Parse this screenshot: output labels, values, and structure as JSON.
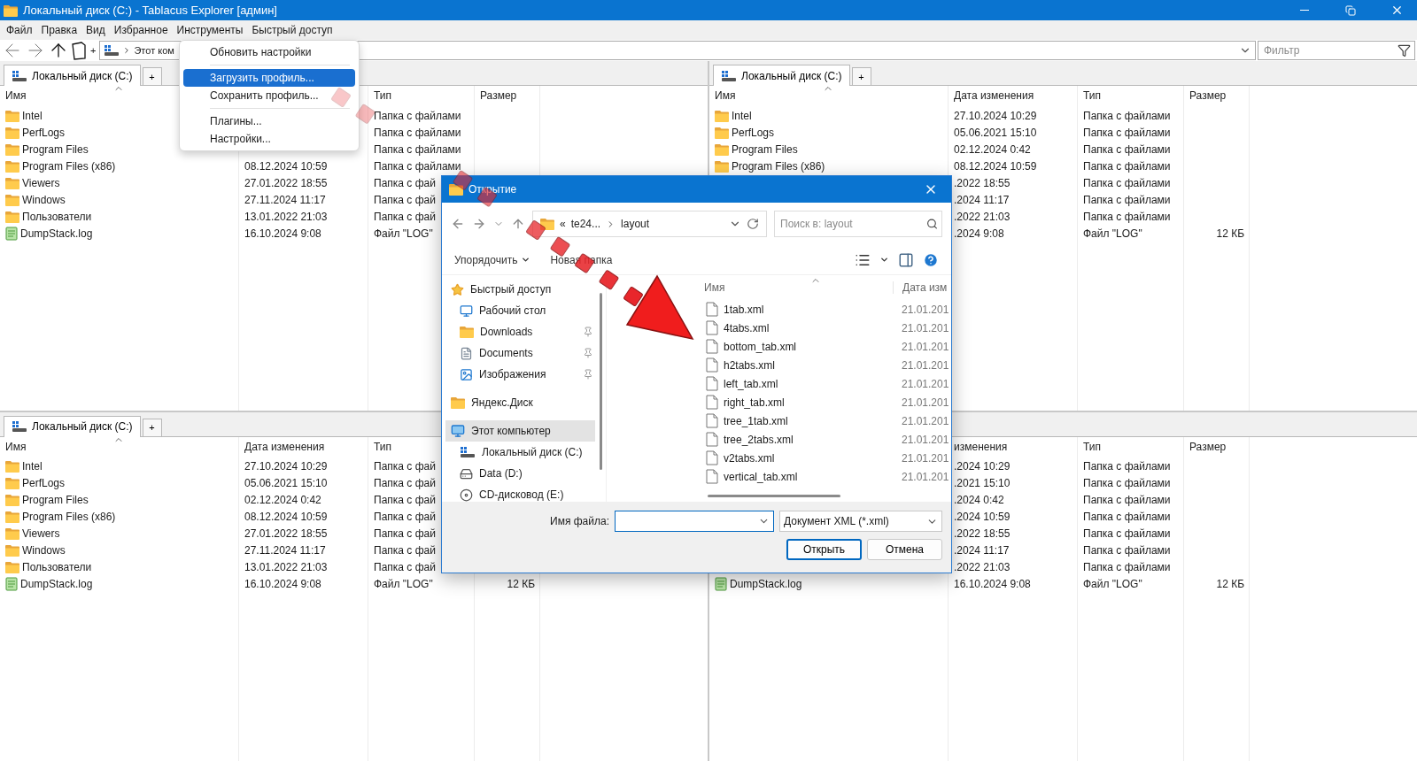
{
  "window": {
    "title": "Локальный диск (C:) - Tablacus Explorer [админ]"
  },
  "menu_bar": [
    "Файл",
    "Правка",
    "Вид",
    "Избранное",
    "Инструменты",
    "Быстрый доступ"
  ],
  "toolbar": {
    "new_tab": "+",
    "address": "Этот ком",
    "filter_placeholder": "Фильтр"
  },
  "tools_menu": [
    {
      "kind": "item",
      "label": "Обновить настройки",
      "selected": false
    },
    {
      "kind": "separator"
    },
    {
      "kind": "item",
      "label": "Загрузить профиль...",
      "selected": true
    },
    {
      "kind": "item",
      "label": "Сохранить профиль...",
      "selected": false
    },
    {
      "kind": "separator"
    },
    {
      "kind": "item",
      "label": "Плагины...",
      "selected": false
    },
    {
      "kind": "item",
      "label": "Настройки...",
      "selected": false
    }
  ],
  "panes": [
    {
      "tab": {
        "label": "Локальный диск (C:)",
        "selected": true
      },
      "new_tab": "+",
      "columns": [
        {
          "kind": "name",
          "label": "Имя"
        },
        {
          "kind": "date"
        },
        {
          "kind": "type",
          "label": "Тип"
        },
        {
          "kind": "size",
          "label": "Размер"
        }
      ],
      "rows": [
        {
          "kind": "folder",
          "name": "Intel",
          "type": "Папка с файлами"
        },
        {
          "kind": "folder",
          "name": "PerfLogs",
          "type": "Папка с файлами"
        },
        {
          "kind": "folder",
          "name": "Program Files",
          "type": "Папка с файлами"
        },
        {
          "kind": "folder",
          "name": "Program Files (x86)",
          "date": "08.12.2024 10:59",
          "type": "Папка с файлами"
        },
        {
          "kind": "folder",
          "name": "Viewers",
          "date": "27.01.2022 18:55",
          "type": "Папка с фай"
        },
        {
          "kind": "folder",
          "name": "Windows",
          "date": "27.11.2024 11:17",
          "type": "Папка с фай"
        },
        {
          "kind": "folder",
          "name": "Пользователи",
          "date": "13.01.2022 21:03",
          "type": "Папка с фай"
        },
        {
          "kind": "file",
          "name": "DumpStack.log",
          "date": "16.10.2024 9:08",
          "type": "Файл \"LOG\""
        }
      ]
    },
    {
      "tab": {
        "label": "Локальный диск (C:)",
        "selected": true
      },
      "new_tab": "+",
      "columns": [
        {
          "kind": "name",
          "label": "Имя"
        },
        {
          "kind": "date",
          "label": "Дата изменения"
        },
        {
          "kind": "type",
          "label": "Тип"
        },
        {
          "kind": "size",
          "label": "Размер"
        }
      ],
      "rows": [
        {
          "kind": "folder",
          "name": "Intel",
          "date": "27.10.2024 10:29",
          "type": "Папка с файлами"
        },
        {
          "kind": "folder",
          "name": "PerfLogs",
          "date": "05.06.2021 15:10",
          "type": "Папка с файлами"
        },
        {
          "kind": "folder",
          "name": "Program Files",
          "date": "02.12.2024 0:42",
          "type": "Папка с файлами"
        },
        {
          "kind": "folder",
          "name": "Program Files (x86)",
          "date": "08.12.2024 10:59",
          "type": "Папка с файлами"
        },
        {
          "date": ".2022 18:55",
          "type": "Папка с файлами"
        },
        {
          "date": ".2024 11:17",
          "type": "Папка с файлами"
        },
        {
          "date": ".2022 21:03",
          "type": "Папка с файлами"
        },
        {
          "date": ".2024 9:08",
          "type": "Файл \"LOG\"",
          "size": "12 КБ"
        }
      ]
    },
    {
      "tab": {
        "label": "Локальный диск (C:)",
        "selected": true
      },
      "new_tab": "+",
      "columns": [
        {
          "kind": "name",
          "label": "Имя"
        },
        {
          "kind": "date",
          "label": "Дата изменения"
        },
        {
          "kind": "type",
          "label": "Тип"
        },
        {
          "kind": "size"
        }
      ],
      "rows": [
        {
          "kind": "folder",
          "name": "Intel",
          "date": "27.10.2024 10:29",
          "type": "Папка с фай"
        },
        {
          "kind": "folder",
          "name": "PerfLogs",
          "date": "05.06.2021 15:10",
          "type": "Папка с фай"
        },
        {
          "kind": "folder",
          "name": "Program Files",
          "date": "02.12.2024 0:42",
          "type": "Папка с фай"
        },
        {
          "kind": "folder",
          "name": "Program Files (x86)",
          "date": "08.12.2024 10:59",
          "type": "Папка с фай"
        },
        {
          "kind": "folder",
          "name": "Viewers",
          "date": "27.01.2022 18:55",
          "type": "Папка с фай"
        },
        {
          "kind": "folder",
          "name": "Windows",
          "date": "27.11.2024 11:17",
          "type": "Папка с фай"
        },
        {
          "kind": "folder",
          "name": "Пользователи",
          "date": "13.01.2022 21:03",
          "type": "Папка с фай"
        },
        {
          "kind": "file",
          "name": "DumpStack.log",
          "date": "16.10.2024 9:08",
          "type": "Файл \"LOG\"",
          "size": "12 КБ"
        }
      ]
    },
    {
      "columns": [
        {
          "kind": "name"
        },
        {
          "kind": "date",
          "label": "изменения"
        },
        {
          "kind": "type",
          "label": "Тип"
        },
        {
          "kind": "size",
          "label": "Размер"
        }
      ],
      "rows": [
        {
          "date": ".2024 10:29",
          "type": "Папка с файлами"
        },
        {
          "date": ".2021 15:10",
          "type": "Папка с файлами"
        },
        {
          "date": ".2024 0:42",
          "type": "Папка с файлами"
        },
        {
          "date": ".2024 10:59",
          "type": "Папка с файлами"
        },
        {
          "date": ".2022 18:55",
          "type": "Папка с файлами"
        },
        {
          "date": ".2024 11:17",
          "type": "Папка с файлами"
        },
        {
          "date": ".2022 21:03",
          "type": "Папка с файлами"
        },
        {
          "kind": "file",
          "name": "DumpStack.log",
          "date": "16.10.2024 9:08",
          "type": "Файл \"LOG\"",
          "size": "12 КБ"
        }
      ]
    }
  ],
  "dialog": {
    "title": "Открытие",
    "breadcrumb": {
      "overflow": "«",
      "items": [
        "te24...",
        "layout"
      ]
    },
    "search_placeholder": "Поиск в: layout",
    "commands": [
      "Упорядочить",
      "Новая папка"
    ],
    "nav": [
      {
        "kind": "quick_access",
        "label": "Быстрый доступ",
        "selected": false,
        "children": [
          {
            "kind": "desktop",
            "label": "Рабочий стол",
            "selected": false,
            "pinned": false
          },
          {
            "kind": "downloads",
            "label": "Downloads",
            "selected": false,
            "pinned": true
          },
          {
            "kind": "documents",
            "label": "Documents",
            "selected": false,
            "pinned": true
          },
          {
            "kind": "pictures",
            "label": "Изображения",
            "selected": false,
            "pinned": true
          }
        ]
      },
      {
        "kind": "cloud",
        "label": "Яндекс.Диск",
        "selected": false
      },
      {
        "kind": "computer",
        "label": "Этот компьютер",
        "selected": true,
        "children": [
          {
            "kind": "system_drive",
            "label": "Локальный диск (C:)",
            "selected": false
          },
          {
            "kind": "drive",
            "label": "Data (D:)",
            "selected": false
          },
          {
            "kind": "cd_drive",
            "label": "CD-дисковод (E:)",
            "selected": false
          }
        ]
      }
    ],
    "file_columns": [
      "Имя",
      "Дата изм"
    ],
    "files": [
      {
        "name": "1tab.xml",
        "date": "21.01.201"
      },
      {
        "name": "4tabs.xml",
        "date": "21.01.201"
      },
      {
        "name": "bottom_tab.xml",
        "date": "21.01.201"
      },
      {
        "name": "h2tabs.xml",
        "date": "21.01.201"
      },
      {
        "name": "left_tab.xml",
        "date": "21.01.201"
      },
      {
        "name": "right_tab.xml",
        "date": "21.01.201"
      },
      {
        "name": "tree_1tab.xml",
        "date": "21.01.201"
      },
      {
        "name": "tree_2tabs.xml",
        "date": "21.01.201"
      },
      {
        "name": "v2tabs.xml",
        "date": "21.01.201"
      },
      {
        "name": "vertical_tab.xml",
        "date": "21.01.201"
      }
    ],
    "file_name_label": "Имя файла:",
    "file_type": "Документ XML (*.xml)",
    "buttons": [
      {
        "label": "Открыть",
        "default": true
      },
      {
        "label": "Отмена",
        "default": false
      }
    ]
  }
}
